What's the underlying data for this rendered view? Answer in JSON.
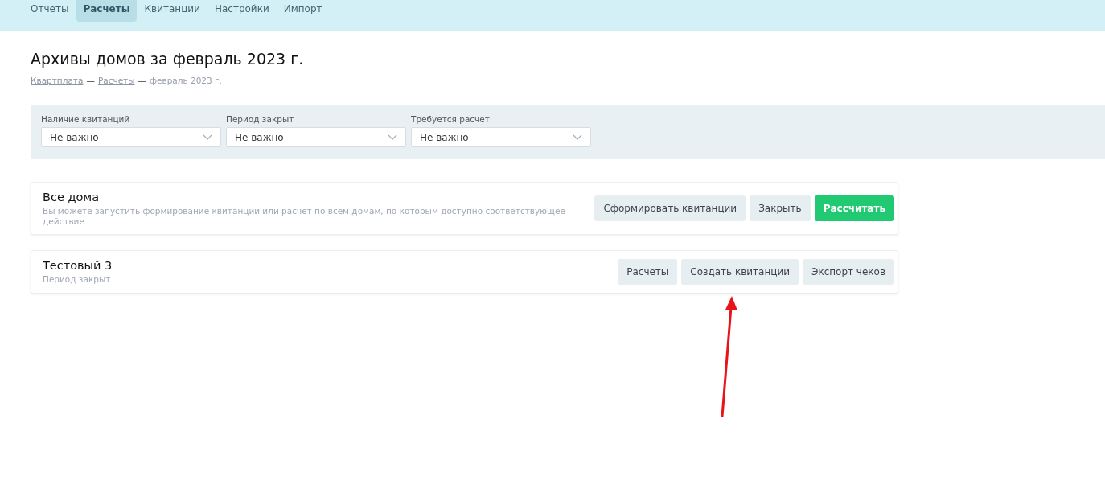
{
  "nav": {
    "tabs": [
      {
        "label": "Отчеты",
        "selected": false
      },
      {
        "label": "Расчеты",
        "selected": true
      },
      {
        "label": "Квитанции",
        "selected": false
      },
      {
        "label": "Настройки",
        "selected": false
      },
      {
        "label": "Импорт",
        "selected": false
      }
    ]
  },
  "page": {
    "title": "Архивы домов за февраль 2023 г.",
    "breadcrumbs": [
      {
        "label": "Квартплата",
        "kind": "link"
      },
      {
        "label": "Расчеты",
        "kind": "link"
      },
      {
        "label": "февраль 2023 г.",
        "kind": "current"
      }
    ],
    "separator": "—"
  },
  "filters": [
    {
      "label": "Наличие квитанций",
      "value": "Не важно"
    },
    {
      "label": "Период закрыт",
      "value": "Не важно"
    },
    {
      "label": "Требуется расчет",
      "value": "Не важно"
    }
  ],
  "cards": [
    {
      "title": "Все дома",
      "subtitle": "Вы можете запустить формирование квитанций или расчет по всем домам, по которым доступно соответствующее действие",
      "buttons": [
        {
          "label": "Сформировать квитанции",
          "kind": "secondary"
        },
        {
          "label": "Закрыть",
          "kind": "secondary"
        },
        {
          "label": "Рассчитать",
          "kind": "primary"
        }
      ]
    },
    {
      "title": "Тестовый 3",
      "subtitle": "Период закрыт",
      "buttons": [
        {
          "label": "Расчеты",
          "kind": "secondary"
        },
        {
          "label": "Создать квитанции",
          "kind": "secondary"
        },
        {
          "label": "Экспорт чеков",
          "kind": "secondary"
        }
      ]
    }
  ]
}
